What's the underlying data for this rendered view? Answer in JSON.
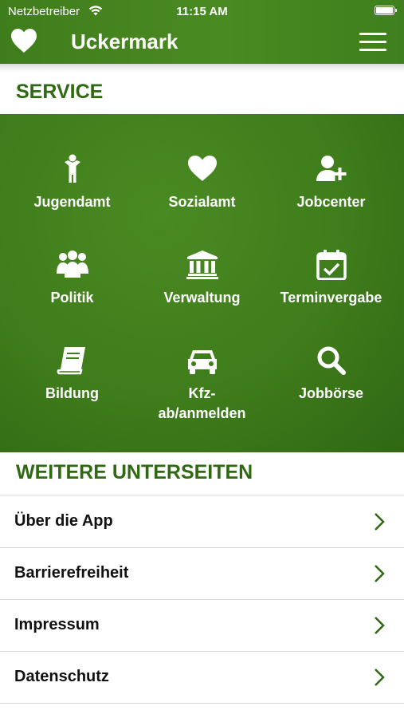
{
  "status_bar": {
    "carrier": "Netzbetreiber",
    "time": "11:15 AM"
  },
  "nav": {
    "title": "Uckermark"
  },
  "service": {
    "title": "SERVICE",
    "tiles": [
      {
        "label": "Jugendamt",
        "icon": "child-icon"
      },
      {
        "label": "Sozialamt",
        "icon": "heart-icon"
      },
      {
        "label": "Jobcenter",
        "icon": "add-user-icon"
      },
      {
        "label": "Politik",
        "icon": "group-icon"
      },
      {
        "label": "Verwaltung",
        "icon": "building-icon"
      },
      {
        "label": "Terminvergabe",
        "icon": "calendar-check-icon"
      },
      {
        "label": "Bildung",
        "icon": "book-icon"
      },
      {
        "label": "Kfz-",
        "label2": "ab/anmelden",
        "icon": "car-icon"
      },
      {
        "label": "Jobbörse",
        "icon": "search-icon"
      }
    ]
  },
  "more": {
    "title": "WEITERE UNTERSEITEN",
    "items": [
      {
        "label": "Über die App"
      },
      {
        "label": "Barrierefreiheit"
      },
      {
        "label": "Impressum"
      },
      {
        "label": "Datenschutz"
      }
    ]
  },
  "colors": {
    "brand_green": "#3f7d1c",
    "section_title": "#2f6a12"
  }
}
